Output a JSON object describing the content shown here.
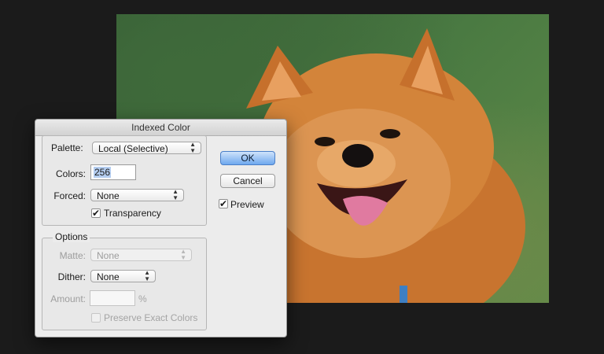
{
  "dialog": {
    "title": "Indexed Color",
    "palette_label": "Palette:",
    "palette_value": "Local (Selective)",
    "colors_label": "Colors:",
    "colors_value": "256",
    "forced_label": "Forced:",
    "forced_value": "None",
    "transparency_label": "Transparency",
    "transparency_checked": true,
    "options_title": "Options",
    "matte_label": "Matte:",
    "matte_value": "None",
    "dither_label": "Dither:",
    "dither_value": "None",
    "amount_label": "Amount:",
    "amount_value": "",
    "amount_unit": "%",
    "preserve_label": "Preserve Exact Colors",
    "preserve_checked": false,
    "ok_label": "OK",
    "cancel_label": "Cancel",
    "preview_label": "Preview",
    "preview_checked": true
  },
  "icons": {
    "select_arrows": "up-down-chevron-icon",
    "checkmark": "checkmark-icon"
  },
  "colors": {
    "default_button": "#6ea8ee",
    "background": "#1b1b1b",
    "dialog_bg": "#ececec"
  }
}
